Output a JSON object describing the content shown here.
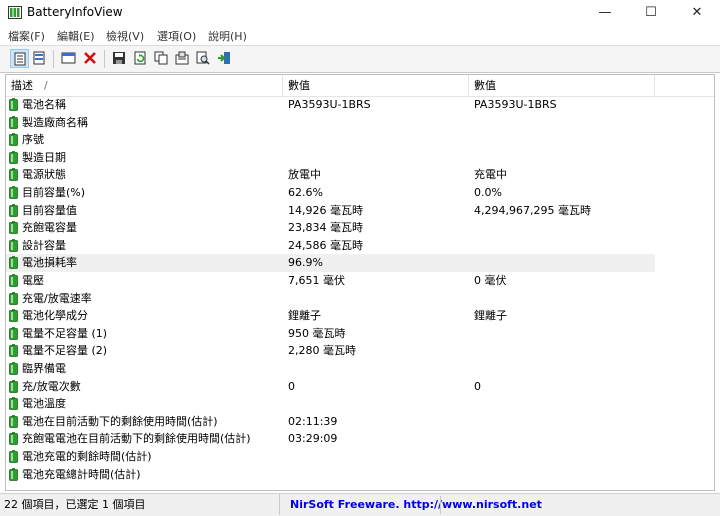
{
  "window": {
    "title": "BatteryInfoView",
    "minimize": "—",
    "maximize": "☐",
    "close": "✕"
  },
  "menu": [
    "檔案(F)",
    "編輯(E)",
    "檢視(V)",
    "選項(O)",
    "說明(H)"
  ],
  "columns": [
    "描述",
    "數值",
    "數值"
  ],
  "sort_indicator": "/",
  "rows": [
    {
      "label": "電池名稱",
      "v1": "PA3593U-1BRS",
      "v2": "PA3593U-1BRS"
    },
    {
      "label": "製造廠商名稱",
      "v1": "",
      "v2": ""
    },
    {
      "label": "序號",
      "v1": "",
      "v2": ""
    },
    {
      "label": "製造日期",
      "v1": "",
      "v2": ""
    },
    {
      "label": "電源狀態",
      "v1": "放電中",
      "v2": "充電中"
    },
    {
      "label": "目前容量(%)",
      "v1": "62.6%",
      "v2": "0.0%"
    },
    {
      "label": "目前容量值",
      "v1": "14,926 毫瓦時",
      "v2": "4,294,967,295 毫瓦時"
    },
    {
      "label": "充飽電容量",
      "v1": "23,834 毫瓦時",
      "v2": ""
    },
    {
      "label": "設計容量",
      "v1": "24,586 毫瓦時",
      "v2": ""
    },
    {
      "label": "電池損耗率",
      "v1": "96.9%",
      "v2": ""
    },
    {
      "label": "電壓",
      "v1": "7,651 毫伏",
      "v2": "0 毫伏"
    },
    {
      "label": "充電/放電速率",
      "v1": "",
      "v2": ""
    },
    {
      "label": "電池化學成分",
      "v1": "鋰離子",
      "v2": "鋰離子"
    },
    {
      "label": "電量不足容量 (1)",
      "v1": "950 毫瓦時",
      "v2": ""
    },
    {
      "label": "電量不足容量 (2)",
      "v1": "2,280 毫瓦時",
      "v2": ""
    },
    {
      "label": "臨界備電",
      "v1": "",
      "v2": ""
    },
    {
      "label": "充/放電次數",
      "v1": "0",
      "v2": "0"
    },
    {
      "label": "電池溫度",
      "v1": "",
      "v2": ""
    },
    {
      "label": "電池在目前活動下的剩餘使用時間(估計)",
      "v1": "02:11:39",
      "v2": ""
    },
    {
      "label": "充飽電電池在目前活動下的剩餘使用時間(估計)",
      "v1": "03:29:09",
      "v2": ""
    },
    {
      "label": "電池充電的剩餘時間(估計)",
      "v1": "",
      "v2": ""
    },
    {
      "label": "電池充電總計時間(估計)",
      "v1": "",
      "v2": ""
    }
  ],
  "selected_row": 9,
  "status": {
    "left": "22 個項目，已選定 1 個項目",
    "right": "NirSoft Freeware.  http://www.nirsoft.net"
  },
  "colors": {
    "battery_icon": "#2e9e2e",
    "selection": "#f0f0f0",
    "link": "#0000ee"
  }
}
